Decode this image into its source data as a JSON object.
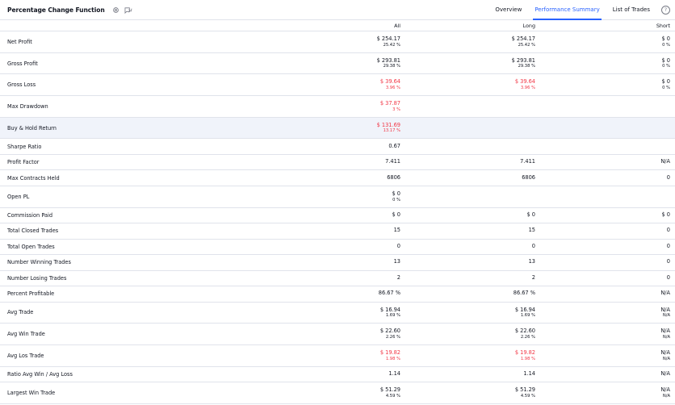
{
  "title": "Percentage Change Function",
  "tabs": [
    "Overview",
    "Performance Summary",
    "List of Trades"
  ],
  "active_tab": "Performance Summary",
  "columns": [
    "All",
    "Long",
    "Short"
  ],
  "colors": {
    "accent": "#2962ff",
    "negative": "#f23645",
    "row_highlight": "#f0f3fa"
  },
  "rows": [
    {
      "label": "Net Profit",
      "all": [
        "$ 254.17",
        "25.42 %"
      ],
      "long": [
        "$ 254.17",
        "25.42 %"
      ],
      "short": [
        "$ 0",
        "0 %"
      ]
    },
    {
      "label": "Gross Profit",
      "all": [
        "$ 293.81",
        "29.38 %"
      ],
      "long": [
        "$ 293.81",
        "29.38 %"
      ],
      "short": [
        "$ 0",
        "0 %"
      ]
    },
    {
      "label": "Gross Loss",
      "all": [
        "$ 39.64",
        "3.96 %"
      ],
      "long": [
        "$ 39.64",
        "3.96 %"
      ],
      "short": [
        "$ 0",
        "0 %"
      ],
      "negative": true
    },
    {
      "label": "Max Drawdown",
      "all": [
        "$ 37.87",
        "3 %"
      ],
      "long": [
        "",
        ""
      ],
      "short": [
        "",
        ""
      ],
      "negative": true
    },
    {
      "label": "Buy & Hold Return",
      "all": [
        "$ 131.69",
        "13.17 %"
      ],
      "long": [
        "",
        ""
      ],
      "short": [
        "",
        ""
      ],
      "negative": true
    },
    {
      "label": "Sharpe Ratio",
      "all": [
        "0.67"
      ],
      "long": [
        ""
      ],
      "short": [
        ""
      ]
    },
    {
      "label": "Profit Factor",
      "all": [
        "7.411"
      ],
      "long": [
        "7.411"
      ],
      "short": [
        "N/A"
      ]
    },
    {
      "label": "Max Contracts Held",
      "all": [
        "6806"
      ],
      "long": [
        "6806"
      ],
      "short": [
        "0"
      ]
    },
    {
      "label": "Open PL",
      "all": [
        "$ 0",
        "0 %"
      ],
      "long": [
        "",
        ""
      ],
      "short": [
        "",
        ""
      ]
    },
    {
      "label": "Commission Paid",
      "all": [
        "$ 0"
      ],
      "long": [
        "$ 0"
      ],
      "short": [
        "$ 0"
      ]
    },
    {
      "label": "Total Closed Trades",
      "all": [
        "15"
      ],
      "long": [
        "15"
      ],
      "short": [
        "0"
      ]
    },
    {
      "label": "Total Open Trades",
      "all": [
        "0"
      ],
      "long": [
        "0"
      ],
      "short": [
        "0"
      ]
    },
    {
      "label": "Number Winning Trades",
      "all": [
        "13"
      ],
      "long": [
        "13"
      ],
      "short": [
        "0"
      ]
    },
    {
      "label": "Number Losing Trades",
      "all": [
        "2"
      ],
      "long": [
        "2"
      ],
      "short": [
        "0"
      ]
    },
    {
      "label": "Percent Profitable",
      "all": [
        "86.67 %"
      ],
      "long": [
        "86.67 %"
      ],
      "short": [
        "N/A"
      ]
    },
    {
      "label": "Avg Trade",
      "all": [
        "$ 16.94",
        "1.69 %"
      ],
      "long": [
        "$ 16.94",
        "1.69 %"
      ],
      "short": [
        "N/A",
        "N/A"
      ]
    },
    {
      "label": "Avg Win Trade",
      "all": [
        "$ 22.60",
        "2.26 %"
      ],
      "long": [
        "$ 22.60",
        "2.26 %"
      ],
      "short": [
        "N/A",
        "N/A"
      ]
    },
    {
      "label": "Avg Los Trade",
      "all": [
        "$ 19.82",
        "1.98 %"
      ],
      "long": [
        "$ 19.82",
        "1.98 %"
      ],
      "short": [
        "N/A",
        "N/A"
      ],
      "negative": true
    },
    {
      "label": "Ratio Avg Win / Avg Loss",
      "all": [
        "1.14"
      ],
      "long": [
        "1.14"
      ],
      "short": [
        "N/A"
      ]
    },
    {
      "label": "Largest Win Trade",
      "all": [
        "$ 51.29",
        "4.59 %"
      ],
      "long": [
        "$ 51.29",
        "4.59 %"
      ],
      "short": [
        "N/A",
        "N/A"
      ]
    }
  ]
}
